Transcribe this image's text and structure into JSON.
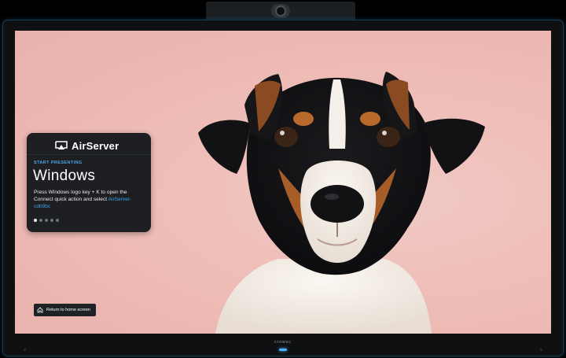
{
  "device": {
    "brand_text": "crowoc",
    "power_led_color": "#4fb3ff"
  },
  "card": {
    "logo_text": "AirServer",
    "start_label": "START PRESENTING",
    "platform": "Windows",
    "instructions_prefix": "Press Windows logo key + K to open the Connect quick action and select ",
    "device_name": "AirServer-cdb9bc",
    "carousel_total": 5,
    "carousel_active": 1,
    "accent_color": "#4aa6e8",
    "icon": "airplay-icon"
  },
  "home_button": {
    "label": "Return to home screen",
    "icon": "home-icon"
  },
  "background": {
    "subject": "dog-photo",
    "color": "#efbdb7"
  }
}
